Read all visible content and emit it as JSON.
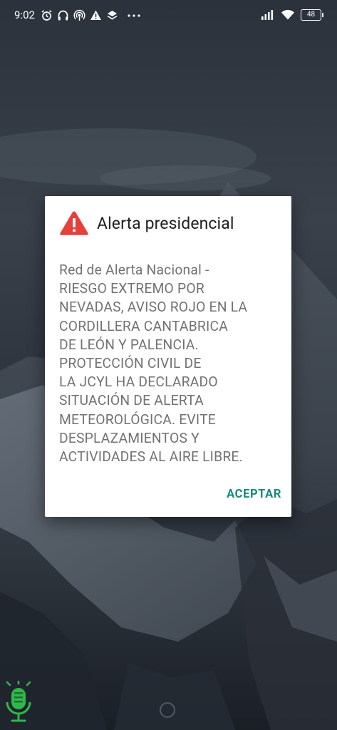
{
  "status_bar": {
    "time": "9:02",
    "battery": "48",
    "left_icons": [
      "alarm-icon",
      "headphones-icon",
      "hotspot-icon",
      "warning-icon",
      "layers-icon",
      "more-icon"
    ],
    "right_icons": [
      "signal-icon",
      "wifi-icon",
      "battery-icon"
    ]
  },
  "dialog": {
    "icon": "warning-triangle-icon",
    "title": "Alerta presidencial",
    "body_lines": [
      "Red de Alerta Nacional -",
      "RIESGO EXTREMO POR",
      "NEVADAS, AVISO ROJO EN LA",
      "CORDILLERA CANTABRICA",
      "DE LEÓN Y PALENCIA.",
      "PROTECCIÓN CIVIL DE",
      "LA JCYL HA DECLARADO",
      "SITUACIÓN DE ALERTA",
      "METEOROLÓGICA. EVITE",
      "DESPLAZAMIENTOS Y",
      "ACTIVIDADES AL AIRE LIBRE."
    ],
    "button_label": "ACEPTAR"
  },
  "colors": {
    "warning": "#e5413b",
    "accent": "#138a7c",
    "watermark": "#2fb84a"
  }
}
